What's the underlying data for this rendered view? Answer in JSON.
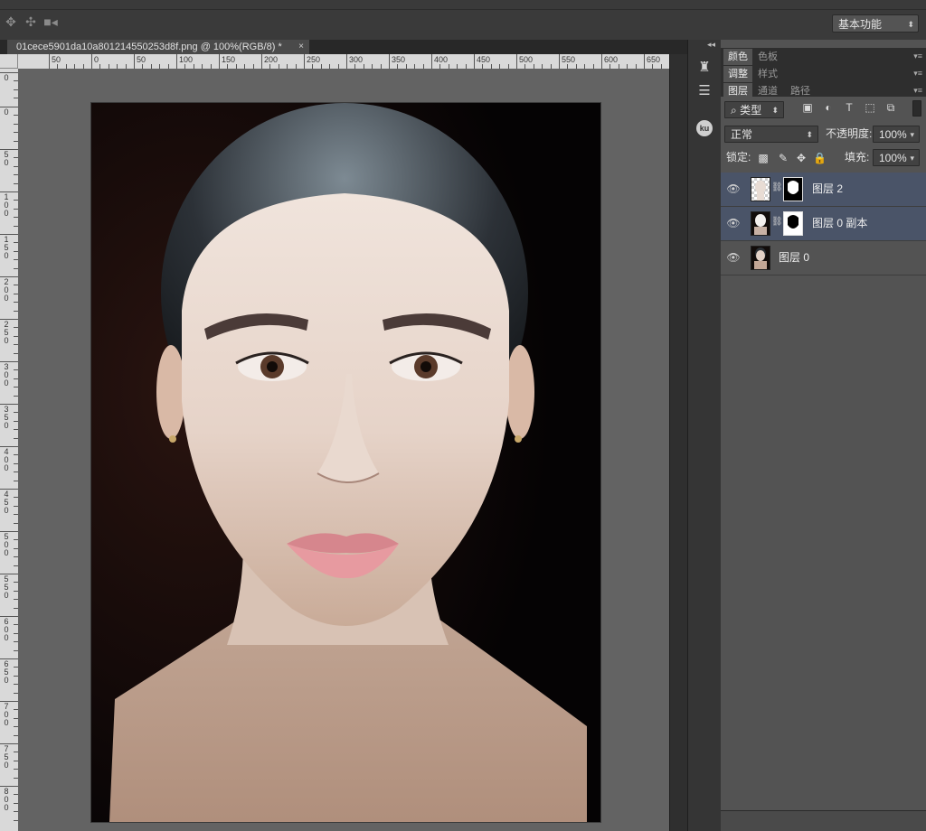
{
  "options_bar": {
    "tool_icons": [
      "move-icon",
      "transform-icon",
      "video-camera-icon"
    ],
    "workspace": "基本功能"
  },
  "document": {
    "tab_title": "01cece5901da10a801214550253d8f.png @ 100%(RGB/8) *",
    "close_label": "×"
  },
  "ruler": {
    "h_labels": [
      "50",
      "0",
      "50",
      "100",
      "150",
      "200",
      "250",
      "300",
      "350",
      "400",
      "450",
      "500",
      "550",
      "600",
      "650"
    ],
    "v_labels": [
      "0",
      "0",
      "50",
      "100",
      "150",
      "200",
      "250",
      "300",
      "350",
      "400",
      "450",
      "500",
      "550",
      "600",
      "650",
      "700",
      "750",
      "800"
    ]
  },
  "dock": {
    "icons": [
      "brush-presets-icon",
      "adjustments-sliders-icon",
      "kuler-icon"
    ],
    "kuler_label": "ku",
    "collapse_left": "◂◂",
    "collapse_right": "▸▸"
  },
  "panels": {
    "group1_tabs": [
      "颜色",
      "色板"
    ],
    "group2_tabs": [
      "调整",
      "样式"
    ],
    "group3_tabs": [
      "图层",
      "通道",
      "路径"
    ],
    "menu_icon": "▾≡"
  },
  "layers_panel": {
    "filter_kind": "类型",
    "filter_icons": [
      "image-filter-icon",
      "adjustment-filter-icon",
      "type-filter-icon",
      "shape-filter-icon",
      "smart-object-filter-icon"
    ],
    "blend_mode": "正常",
    "opacity_label": "不透明度:",
    "opacity_value": "100%",
    "lock_label": "锁定:",
    "lock_icons": [
      "lock-transparent-icon",
      "lock-image-icon",
      "lock-position-icon",
      "lock-all-icon"
    ],
    "fill_label": "填充:",
    "fill_value": "100%",
    "layers": [
      {
        "name": "图层 2",
        "selected": true,
        "has_mask": true,
        "thumb": "transparent"
      },
      {
        "name": "图层 0 副本",
        "selected": true,
        "has_mask": true,
        "thumb": "face-white"
      },
      {
        "name": "图层 0",
        "selected": false,
        "has_mask": false,
        "thumb": "portrait"
      }
    ]
  }
}
